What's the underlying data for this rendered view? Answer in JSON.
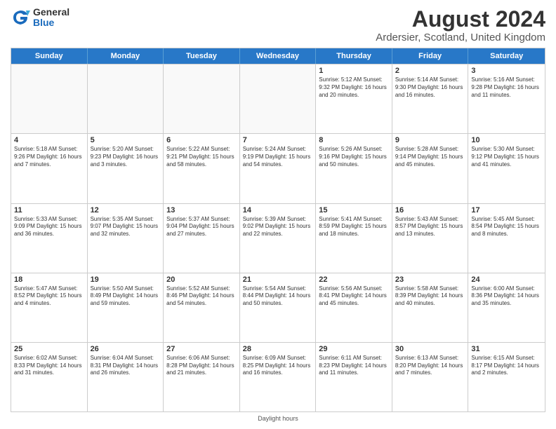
{
  "header": {
    "logo_general": "General",
    "logo_blue": "Blue",
    "main_title": "August 2024",
    "subtitle": "Ardersier, Scotland, United Kingdom"
  },
  "days_of_week": [
    "Sunday",
    "Monday",
    "Tuesday",
    "Wednesday",
    "Thursday",
    "Friday",
    "Saturday"
  ],
  "footer": {
    "label": "Daylight hours"
  },
  "weeks": [
    [
      {
        "day": "",
        "info": ""
      },
      {
        "day": "",
        "info": ""
      },
      {
        "day": "",
        "info": ""
      },
      {
        "day": "",
        "info": ""
      },
      {
        "day": "1",
        "info": "Sunrise: 5:12 AM\nSunset: 9:32 PM\nDaylight: 16 hours\nand 20 minutes."
      },
      {
        "day": "2",
        "info": "Sunrise: 5:14 AM\nSunset: 9:30 PM\nDaylight: 16 hours\nand 16 minutes."
      },
      {
        "day": "3",
        "info": "Sunrise: 5:16 AM\nSunset: 9:28 PM\nDaylight: 16 hours\nand 11 minutes."
      }
    ],
    [
      {
        "day": "4",
        "info": "Sunrise: 5:18 AM\nSunset: 9:26 PM\nDaylight: 16 hours\nand 7 minutes."
      },
      {
        "day": "5",
        "info": "Sunrise: 5:20 AM\nSunset: 9:23 PM\nDaylight: 16 hours\nand 3 minutes."
      },
      {
        "day": "6",
        "info": "Sunrise: 5:22 AM\nSunset: 9:21 PM\nDaylight: 15 hours\nand 58 minutes."
      },
      {
        "day": "7",
        "info": "Sunrise: 5:24 AM\nSunset: 9:19 PM\nDaylight: 15 hours\nand 54 minutes."
      },
      {
        "day": "8",
        "info": "Sunrise: 5:26 AM\nSunset: 9:16 PM\nDaylight: 15 hours\nand 50 minutes."
      },
      {
        "day": "9",
        "info": "Sunrise: 5:28 AM\nSunset: 9:14 PM\nDaylight: 15 hours\nand 45 minutes."
      },
      {
        "day": "10",
        "info": "Sunrise: 5:30 AM\nSunset: 9:12 PM\nDaylight: 15 hours\nand 41 minutes."
      }
    ],
    [
      {
        "day": "11",
        "info": "Sunrise: 5:33 AM\nSunset: 9:09 PM\nDaylight: 15 hours\nand 36 minutes."
      },
      {
        "day": "12",
        "info": "Sunrise: 5:35 AM\nSunset: 9:07 PM\nDaylight: 15 hours\nand 32 minutes."
      },
      {
        "day": "13",
        "info": "Sunrise: 5:37 AM\nSunset: 9:04 PM\nDaylight: 15 hours\nand 27 minutes."
      },
      {
        "day": "14",
        "info": "Sunrise: 5:39 AM\nSunset: 9:02 PM\nDaylight: 15 hours\nand 22 minutes."
      },
      {
        "day": "15",
        "info": "Sunrise: 5:41 AM\nSunset: 8:59 PM\nDaylight: 15 hours\nand 18 minutes."
      },
      {
        "day": "16",
        "info": "Sunrise: 5:43 AM\nSunset: 8:57 PM\nDaylight: 15 hours\nand 13 minutes."
      },
      {
        "day": "17",
        "info": "Sunrise: 5:45 AM\nSunset: 8:54 PM\nDaylight: 15 hours\nand 8 minutes."
      }
    ],
    [
      {
        "day": "18",
        "info": "Sunrise: 5:47 AM\nSunset: 8:52 PM\nDaylight: 15 hours\nand 4 minutes."
      },
      {
        "day": "19",
        "info": "Sunrise: 5:50 AM\nSunset: 8:49 PM\nDaylight: 14 hours\nand 59 minutes."
      },
      {
        "day": "20",
        "info": "Sunrise: 5:52 AM\nSunset: 8:46 PM\nDaylight: 14 hours\nand 54 minutes."
      },
      {
        "day": "21",
        "info": "Sunrise: 5:54 AM\nSunset: 8:44 PM\nDaylight: 14 hours\nand 50 minutes."
      },
      {
        "day": "22",
        "info": "Sunrise: 5:56 AM\nSunset: 8:41 PM\nDaylight: 14 hours\nand 45 minutes."
      },
      {
        "day": "23",
        "info": "Sunrise: 5:58 AM\nSunset: 8:39 PM\nDaylight: 14 hours\nand 40 minutes."
      },
      {
        "day": "24",
        "info": "Sunrise: 6:00 AM\nSunset: 8:36 PM\nDaylight: 14 hours\nand 35 minutes."
      }
    ],
    [
      {
        "day": "25",
        "info": "Sunrise: 6:02 AM\nSunset: 8:33 PM\nDaylight: 14 hours\nand 31 minutes."
      },
      {
        "day": "26",
        "info": "Sunrise: 6:04 AM\nSunset: 8:31 PM\nDaylight: 14 hours\nand 26 minutes."
      },
      {
        "day": "27",
        "info": "Sunrise: 6:06 AM\nSunset: 8:28 PM\nDaylight: 14 hours\nand 21 minutes."
      },
      {
        "day": "28",
        "info": "Sunrise: 6:09 AM\nSunset: 8:25 PM\nDaylight: 14 hours\nand 16 minutes."
      },
      {
        "day": "29",
        "info": "Sunrise: 6:11 AM\nSunset: 8:23 PM\nDaylight: 14 hours\nand 11 minutes."
      },
      {
        "day": "30",
        "info": "Sunrise: 6:13 AM\nSunset: 8:20 PM\nDaylight: 14 hours\nand 7 minutes."
      },
      {
        "day": "31",
        "info": "Sunrise: 6:15 AM\nSunset: 8:17 PM\nDaylight: 14 hours\nand 2 minutes."
      }
    ]
  ]
}
